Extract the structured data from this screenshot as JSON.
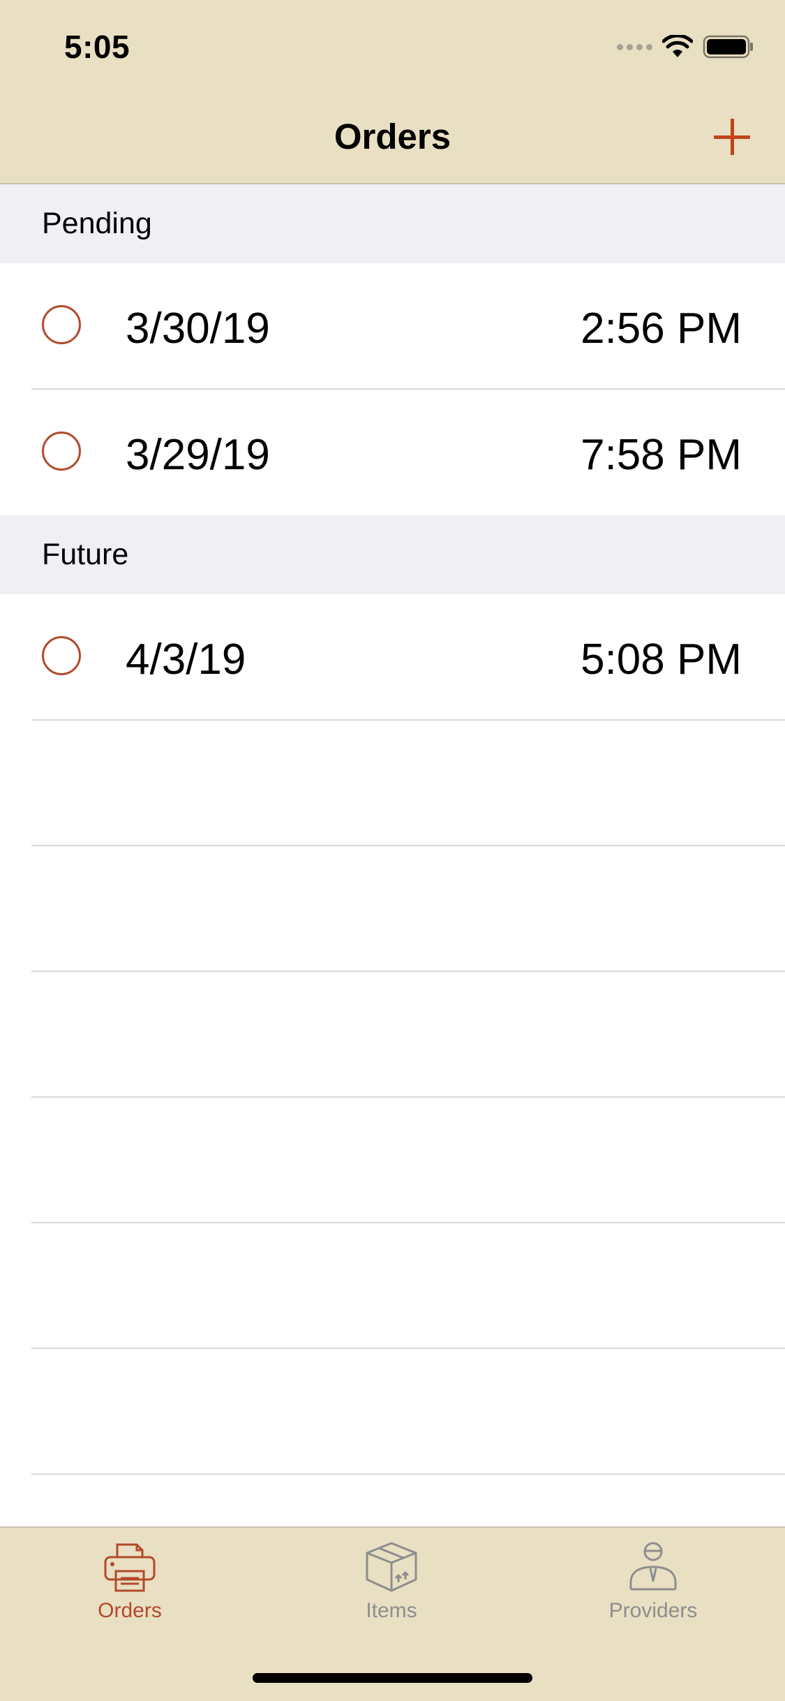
{
  "status_bar": {
    "time": "5:05"
  },
  "nav": {
    "title": "Orders",
    "add_icon": "plus-icon"
  },
  "sections": [
    {
      "header": "Pending",
      "rows": [
        {
          "date": "3/30/19",
          "time": "2:56 PM"
        },
        {
          "date": "3/29/19",
          "time": "7:58 PM"
        }
      ]
    },
    {
      "header": "Future",
      "rows": [
        {
          "date": "4/3/19",
          "time": "5:08 PM"
        }
      ]
    }
  ],
  "tab_bar": {
    "tabs": [
      {
        "label": "Orders",
        "icon": "printer-icon",
        "active": true
      },
      {
        "label": "Items",
        "icon": "box-icon",
        "active": false
      },
      {
        "label": "Providers",
        "icon": "person-icon",
        "active": false
      }
    ]
  },
  "colors": {
    "accent": "#b24a2b",
    "bar_background": "#e9dfc3",
    "section_background": "#efeff4",
    "inactive_tab": "#8e8e8e"
  }
}
